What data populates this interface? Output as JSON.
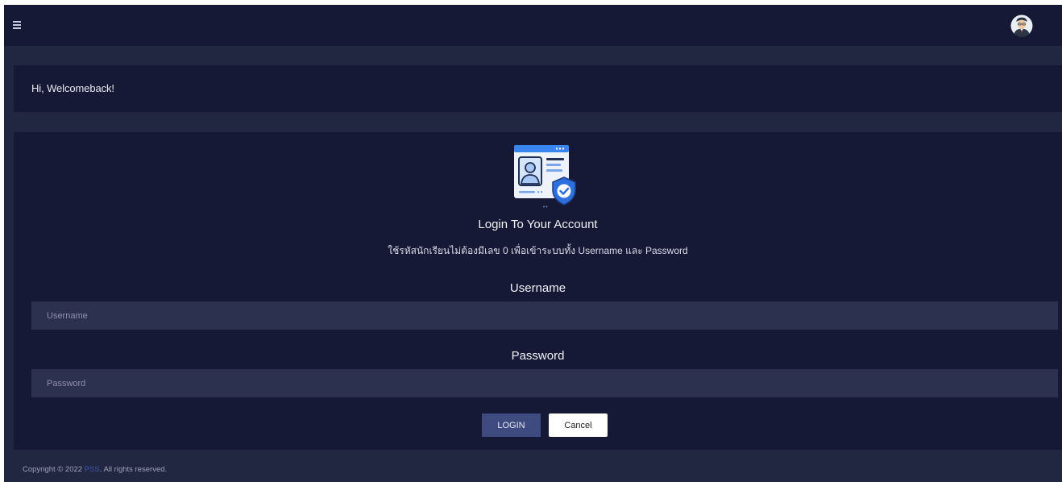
{
  "header": {
    "menu_icon": "hamburger-menu-icon",
    "avatar_icon": "user-avatar-icon"
  },
  "welcome": {
    "text": "Hi, Welcomeback!"
  },
  "login": {
    "illustration_icon": "secure-login-profile-icon",
    "title": "Login To Your Account",
    "hint": "ใช้รหัสนักเรียนไม่ต้องมีเลข 0 เพื่อเข้าระบบทั้ง Username และ Password",
    "username_label": "Username",
    "username_placeholder": "Username",
    "username_value": "",
    "password_label": "Password",
    "password_placeholder": "Password",
    "password_value": "",
    "login_button": "LOGIN",
    "cancel_button": "Cancel"
  },
  "footer": {
    "copyright_prefix": "Copyright © 2022 ",
    "link_text": "PSS",
    "copyright_suffix": ". All rights reserved."
  },
  "colors": {
    "page_background": "#222741",
    "card_background": "#151935",
    "input_background": "#2d3150",
    "primary_button": "#3e4a80",
    "link": "#3f56a8"
  }
}
